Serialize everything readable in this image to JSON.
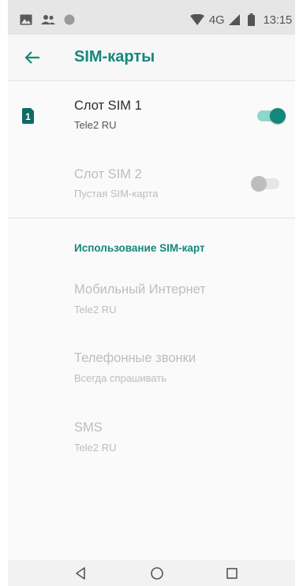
{
  "status_bar": {
    "network_label": "4G",
    "time": "13:15",
    "icons": [
      "image-notification-icon",
      "contacts-notification-icon",
      "circle-notification-icon",
      "wifi-icon",
      "signal-icon",
      "battery-icon"
    ]
  },
  "app_bar": {
    "title": "SIM-карты",
    "back_icon": "arrow-back-icon"
  },
  "sim_slots": [
    {
      "title": "Слот SIM 1",
      "subtitle": "Tele2 RU",
      "badge": "1",
      "enabled": true,
      "toggle_on": true
    },
    {
      "title": "Слот SIM 2",
      "subtitle": "Пустая SIM-карта",
      "enabled": false,
      "toggle_on": false
    }
  ],
  "section": {
    "header": "Использование SIM-карт",
    "items": [
      {
        "title": "Мобильный Интернет",
        "subtitle": "Tele2 RU"
      },
      {
        "title": "Телефонные звонки",
        "subtitle": "Всегда спрашивать"
      },
      {
        "title": "SMS",
        "subtitle": "Tele2 RU"
      }
    ]
  },
  "colors": {
    "accent": "#14877c",
    "toggle_track_on": "#8fd6cd",
    "disabled_text": "#bdbdbd"
  },
  "nav_bar": {
    "icons": [
      "back-triangle-icon",
      "home-circle-icon",
      "recents-square-icon"
    ]
  }
}
